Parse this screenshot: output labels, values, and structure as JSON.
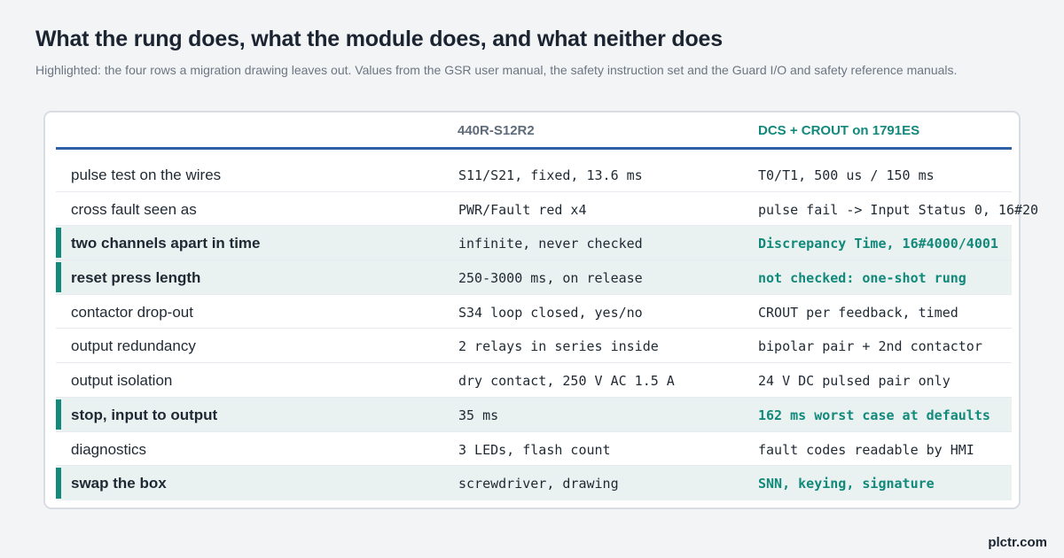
{
  "header": {
    "title": "What the rung does, what the module does, and what neither does",
    "subtitle": "Highlighted: the four rows a migration drawing leaves out. Values from the GSR user manual, the safety instruction set and the Guard I/O and safety reference manuals."
  },
  "table": {
    "columns": [
      "",
      "440R-S12R2",
      "DCS + CROUT on 1791ES"
    ],
    "rows": [
      {
        "label": "pulse test on the wires",
        "c1": "S11/S21, fixed, 13.6 ms",
        "c2": "T0/T1, 500 us / 150 ms",
        "highlight": false
      },
      {
        "label": "cross fault seen as",
        "c1": "PWR/Fault red x4",
        "c2": "pulse fail -> Input Status 0, 16#20",
        "highlight": false
      },
      {
        "label": "two channels apart in time",
        "c1": "infinite, never checked",
        "c2": "Discrepancy Time, 16#4000/4001",
        "highlight": true
      },
      {
        "label": "reset press length",
        "c1": "250-3000 ms, on release",
        "c2": "not checked: one-shot rung",
        "highlight": true
      },
      {
        "label": "contactor drop-out",
        "c1": "S34 loop closed, yes/no",
        "c2": "CROUT per feedback, timed",
        "highlight": false
      },
      {
        "label": "output redundancy",
        "c1": "2 relays in series inside",
        "c2": "bipolar pair + 2nd contactor",
        "highlight": false
      },
      {
        "label": "output isolation",
        "c1": "dry contact, 250 V AC 1.5 A",
        "c2": "24 V DC pulsed pair only",
        "highlight": false
      },
      {
        "label": "stop, input to output",
        "c1": "35 ms",
        "c2": "162 ms worst case at defaults",
        "highlight": true
      },
      {
        "label": "diagnostics",
        "c1": "3 LEDs, flash count",
        "c2": "fault codes readable by HMI",
        "highlight": false
      },
      {
        "label": "swap the box",
        "c1": "screwdriver, drawing",
        "c2": "SNN, keying, signature",
        "highlight": true
      }
    ]
  },
  "footer": {
    "brand": "plctr.com"
  },
  "colors": {
    "accent_teal": "#12897a",
    "header_rule_blue": "#2f5fa7",
    "highlight_bg": "#e9f2f1"
  }
}
